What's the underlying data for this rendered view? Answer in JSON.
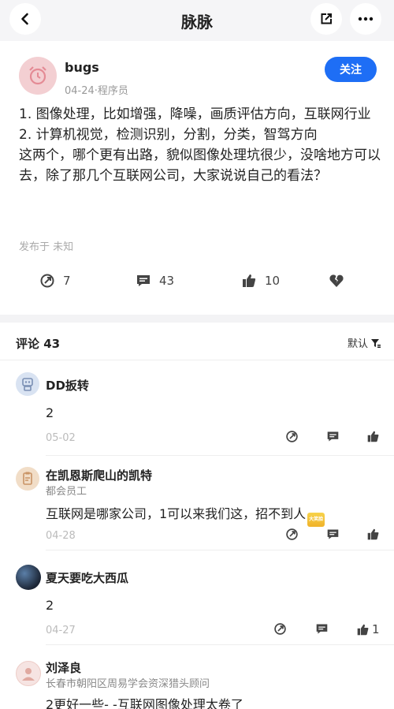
{
  "nav": {
    "title": "脉脉"
  },
  "post": {
    "author": "bugs",
    "meta": "04-24·程序员",
    "follow_label": "关注",
    "content": "1. 图像处理，比如增强，降噪，画质评估方向，互联网行业\n2. 计算机视觉，检测识别，分割，分类，智驾方向\n这两个，哪个更有出路，貌似图像处理坑很少，没啥地方可以去，除了那几个互联网公司，大家说说自己的看法？",
    "published": "发布于 未知",
    "actions": {
      "share_count": "7",
      "comment_count": "43",
      "like_count": "10"
    }
  },
  "comments_header": {
    "label": "评论 43",
    "sort_label": "默认"
  },
  "comments": [
    {
      "name": "DD扳转",
      "subtitle": "",
      "text": "2",
      "date": "05-02",
      "like_count": ""
    },
    {
      "name": "在凯恩斯爬山的凯特",
      "subtitle": "都会员工",
      "text": "互联网是哪家公司，1可以来我们这，招不到人",
      "emoji_text": "大笑脸",
      "date": "04-28",
      "like_count": ""
    },
    {
      "name": "夏天要吃大西瓜",
      "subtitle": "",
      "text": "2",
      "date": "04-27",
      "like_count": "1"
    },
    {
      "name": "刘泽良",
      "subtitle": "长春市朝阳区周易学会资深猎头顾问",
      "text": "2更好一些- -互联网图像处理太卷了",
      "date": "",
      "like_count": ""
    }
  ],
  "colors": {
    "accent": "#1e6ef5",
    "avatar_bg": "#f3cfd2"
  },
  "icons": [
    "back-arrow-icon",
    "share-icon",
    "more-icon",
    "alarm-clock-icon",
    "repost-icon",
    "comment-icon",
    "thumb-up-icon",
    "broken-heart-icon",
    "sort-filter-icon"
  ]
}
